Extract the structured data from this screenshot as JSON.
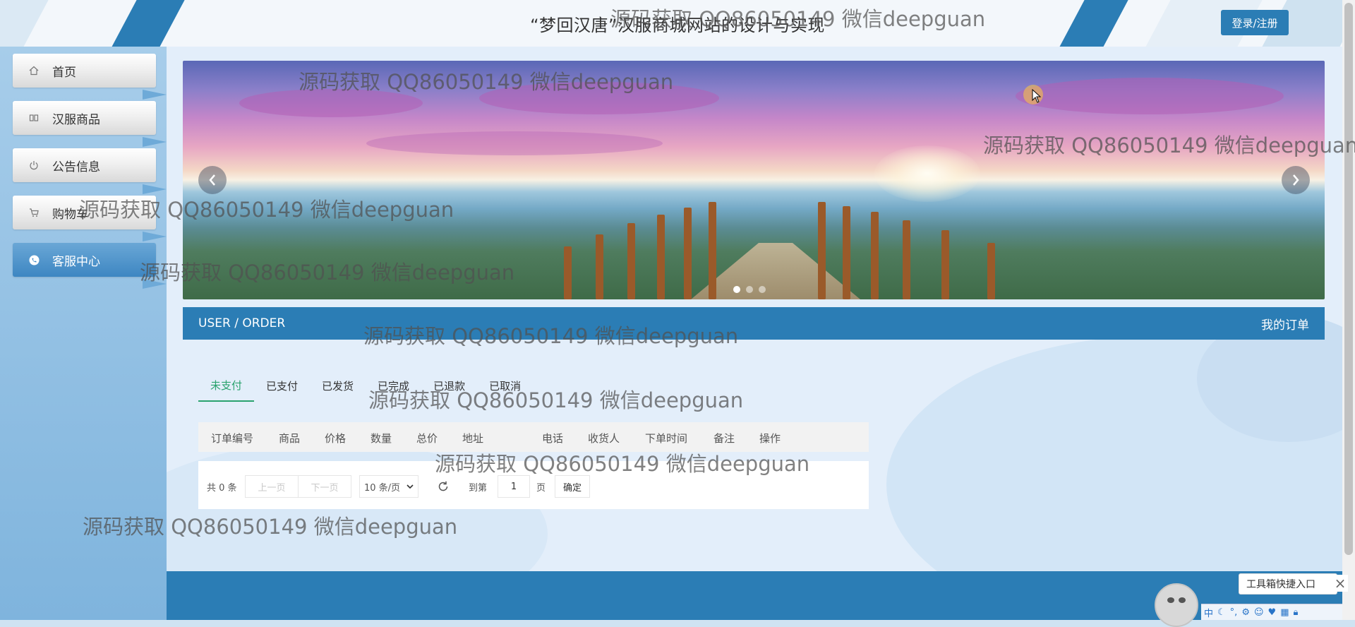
{
  "header": {
    "title": "“梦回汉唐”汉服商城网站的设计与实现",
    "login_button": "登录/注册"
  },
  "sidebar": {
    "items": [
      {
        "label": "首页",
        "icon": "home-icon",
        "active": false
      },
      {
        "label": "汉服商品",
        "icon": "book-icon",
        "active": false
      },
      {
        "label": "公告信息",
        "icon": "power-icon",
        "active": false
      },
      {
        "label": "购物车",
        "icon": "cart-icon",
        "active": false
      },
      {
        "label": "客服中心",
        "icon": "service-icon",
        "active": true
      }
    ]
  },
  "carousel": {
    "dots": 3,
    "active_dot": 1
  },
  "section": {
    "title_en": "USER / ORDER",
    "title_cn": "我的订单"
  },
  "tabs": [
    {
      "label": "未支付",
      "active": true
    },
    {
      "label": "已支付",
      "active": false
    },
    {
      "label": "已发货",
      "active": false
    },
    {
      "label": "已完成",
      "active": false
    },
    {
      "label": "已退款",
      "active": false
    },
    {
      "label": "已取消",
      "active": false
    }
  ],
  "table": {
    "headers": [
      "订单编号",
      "商品",
      "价格",
      "数量",
      "总价",
      "地址",
      "电话",
      "收货人",
      "下单时间",
      "备注",
      "操作"
    ]
  },
  "pager": {
    "total": "共 0 条",
    "prev": "上一页",
    "next": "下一页",
    "page_size": "10 条/页",
    "goto_label": "到第",
    "page_value": "1",
    "page_suffix": "页",
    "confirm": "确定"
  },
  "toolbox": {
    "label": "工具箱快捷入口",
    "ime_mode": "中"
  },
  "watermark": "源码获取 QQ86050149 微信deepguan",
  "colors": {
    "primary": "#2b7db5",
    "active_tab": "#2aa36e"
  }
}
